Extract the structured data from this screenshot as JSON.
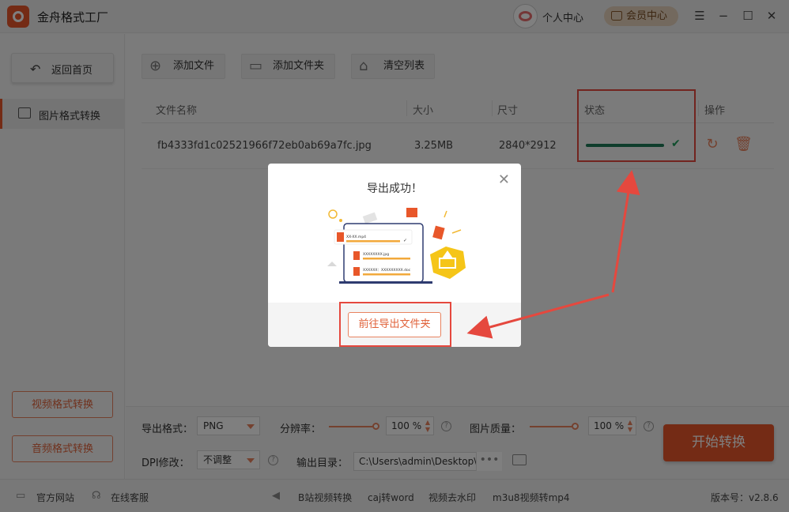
{
  "app": {
    "title": "金舟格式工厂",
    "user_center": "个人中心",
    "vip_center": "会员中心"
  },
  "window_controls": {
    "menu": "☰",
    "minimize": "−",
    "maximize": "☐",
    "close": "✕"
  },
  "sidebar": {
    "back_home": "返回首页",
    "active_item": "图片格式转换",
    "video_convert": "视频格式转换",
    "audio_convert": "音频格式转换"
  },
  "toolbar": {
    "add_file": "添加文件",
    "add_folder": "添加文件夹",
    "clear_list": "清空列表"
  },
  "table": {
    "headers": {
      "name": "文件名称",
      "size": "大小",
      "dimension": "尺寸",
      "status": "状态",
      "action": "操作"
    },
    "rows": [
      {
        "name": "fb4333fd1c02521966f72eb0ab69a7fc.jpg",
        "size": "3.25MB",
        "dimension": "2840*2912",
        "progress": 1.0
      }
    ]
  },
  "settings": {
    "format_label": "导出格式：",
    "format_value": "PNG",
    "resolution_label": "分辨率：",
    "resolution_value": "100 %",
    "resolution_level": 1.0,
    "quality_label": "图片质量：",
    "quality_value": "100 %",
    "quality_level": 1.0,
    "dpi_label": "DPI修改：",
    "dpi_value": "不调整",
    "output_label": "输出目录：",
    "output_path": "C:\\Users\\admin\\Desktop\\",
    "start_button": "开始转换"
  },
  "statusbar": {
    "official_site": "官方网站",
    "online_service": "在线客服",
    "links": [
      "B站视频转换",
      "caj转word",
      "视频去水印",
      "m3u8视频转mp4"
    ],
    "version": "版本号：v2.8.6"
  },
  "dialog": {
    "title": "导出成功！",
    "goto_folder": "前往导出文件夹",
    "illus_file1": "XX-XX.mp4",
    "illus_file2": "XXXXXXXX.jpg",
    "illus_file3": "XXXXXX：XXXXXXXXX.doc"
  },
  "colors": {
    "accent": "#e8572a",
    "progress": "#1e7a58",
    "highlight": "#e5483e"
  }
}
